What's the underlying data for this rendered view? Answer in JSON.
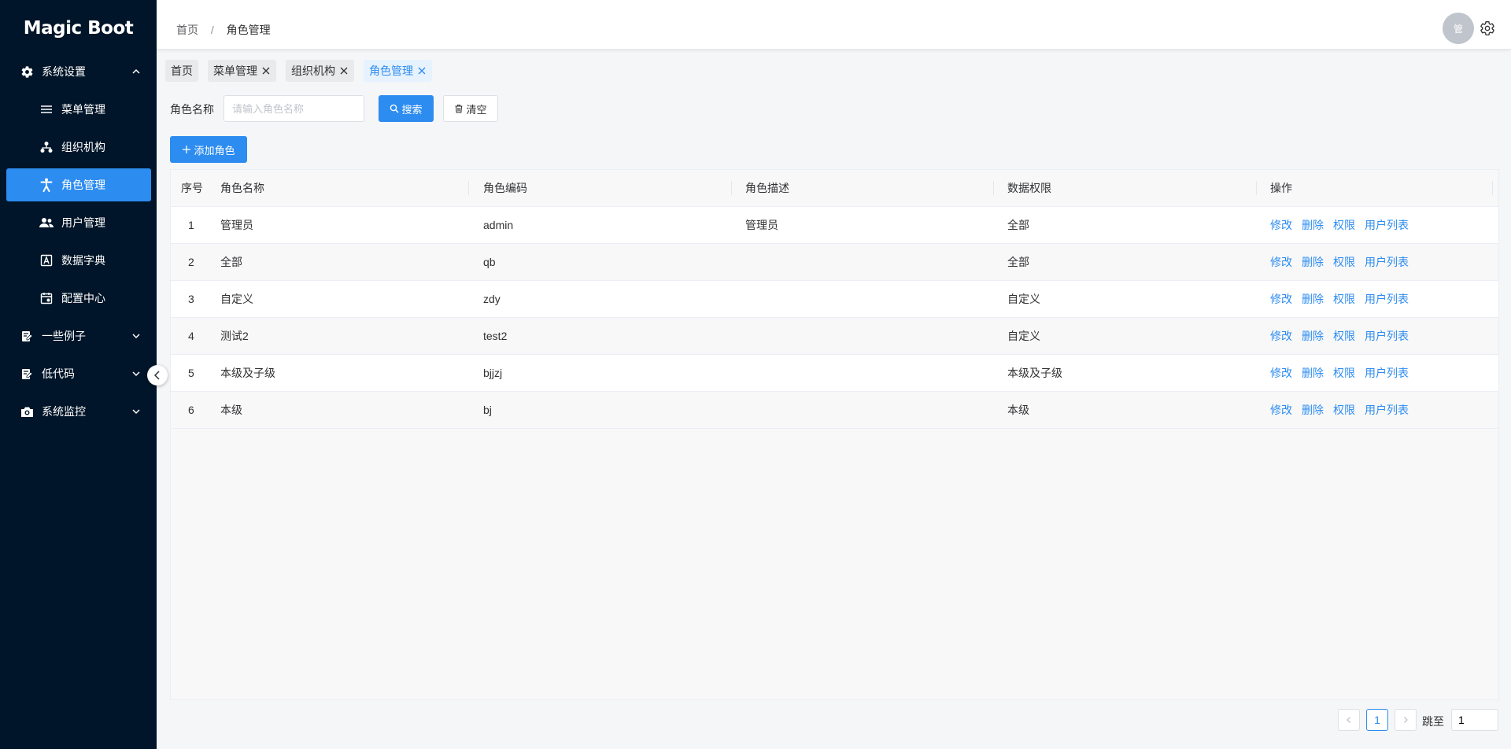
{
  "app": {
    "logo": "Magic Boot"
  },
  "sidebar": {
    "items": [
      {
        "label": "系统设置",
        "icon": "gear-icon",
        "expanded": true
      },
      {
        "label": "菜单管理",
        "icon": "menu-lines-icon"
      },
      {
        "label": "组织机构",
        "icon": "org-tree-icon"
      },
      {
        "label": "角色管理",
        "icon": "person-icon",
        "active": true
      },
      {
        "label": "用户管理",
        "icon": "users-icon"
      },
      {
        "label": "数据字典",
        "icon": "dictionary-icon"
      },
      {
        "label": "配置中心",
        "icon": "config-icon"
      },
      {
        "label": "一些例子",
        "icon": "clipboard-icon"
      },
      {
        "label": "低代码",
        "icon": "clipboard-icon"
      },
      {
        "label": "系统监控",
        "icon": "camera-icon"
      }
    ]
  },
  "header": {
    "breadcrumb": [
      "首页",
      "/",
      "角色管理"
    ],
    "avatar_text": "管"
  },
  "tabs": [
    {
      "label": "首页",
      "closable": false
    },
    {
      "label": "菜单管理",
      "closable": true
    },
    {
      "label": "组织机构",
      "closable": true
    },
    {
      "label": "角色管理",
      "closable": true,
      "active": true
    }
  ],
  "search": {
    "label": "角色名称",
    "placeholder": "请输入角色名称",
    "search_button": "搜索",
    "clear_button": "清空",
    "add_button": "添加角色"
  },
  "table": {
    "columns": [
      "序号",
      "角色名称",
      "角色编码",
      "角色描述",
      "数据权限",
      "操作"
    ],
    "rows": [
      {
        "index": "1",
        "name": "管理员",
        "code": "admin",
        "desc": "管理员",
        "scope": "全部"
      },
      {
        "index": "2",
        "name": "全部",
        "code": "qb",
        "desc": "",
        "scope": "全部"
      },
      {
        "index": "3",
        "name": "自定义",
        "code": "zdy",
        "desc": "",
        "scope": "自定义"
      },
      {
        "index": "4",
        "name": "测试2",
        "code": "test2",
        "desc": "",
        "scope": "自定义"
      },
      {
        "index": "5",
        "name": "本级及子级",
        "code": "bjjzj",
        "desc": "",
        "scope": "本级及子级"
      },
      {
        "index": "6",
        "name": "本级",
        "code": "bj",
        "desc": "",
        "scope": "本级"
      }
    ],
    "actions": [
      "修改",
      "删除",
      "权限",
      "用户列表"
    ]
  },
  "pagination": {
    "current_page": "1",
    "jump_label": "跳至",
    "jump_value": "1"
  },
  "colors": {
    "sidebar_bg": "#001529",
    "primary": "#2d8cf0"
  }
}
